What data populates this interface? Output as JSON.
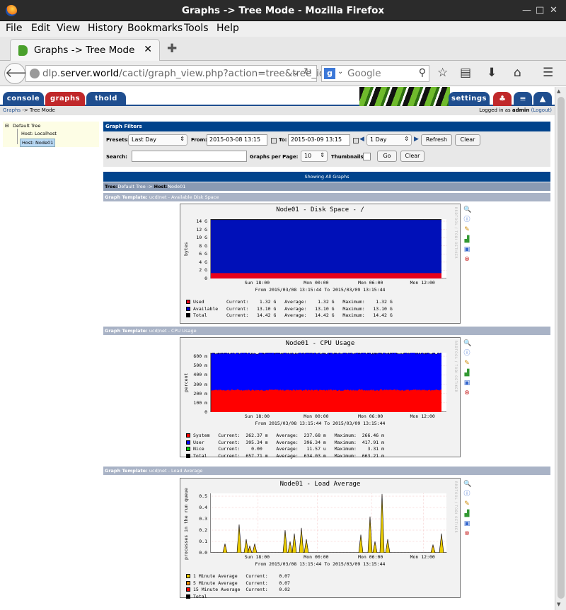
{
  "window": {
    "title": "Graphs -> Tree Mode - Mozilla Firefox"
  },
  "menu": [
    "File",
    "Edit",
    "View",
    "History",
    "Bookmarks",
    "Tools",
    "Help"
  ],
  "browser_tab": {
    "label": "Graphs -> Tree Mode"
  },
  "url": {
    "prefix": "dlp.",
    "host": "server.world",
    "path": "/cacti/graph_view.php?action=tree&tree_id="
  },
  "search": {
    "placeholder": "Google"
  },
  "cacti": {
    "tabs": [
      "console",
      "graphs",
      "thold"
    ],
    "settings": "settings",
    "breadcrumb": {
      "root": "Graphs",
      "rest": " -> Tree Mode"
    },
    "login": {
      "prefix": "Logged in as ",
      "user": "admin",
      "logout": "(Logout)"
    }
  },
  "tree": {
    "root": "Default Tree",
    "items": [
      "Host: Localhost",
      "Host: Node01"
    ]
  },
  "filters": {
    "header": "Graph Filters",
    "presets_label": "Presets:",
    "preset_value": "Last Day",
    "from_label": "From:",
    "from_value": "2015-03-08 13:15",
    "to_label": "To:",
    "to_value": "2015-03-09 13:15",
    "timespan_value": "1 Day",
    "refresh": "Refresh",
    "clear": "Clear",
    "search_label": "Search:",
    "search_value": "",
    "per_page_label": "Graphs per Page:",
    "per_page_value": "10",
    "thumbnails_label": "Thumbnails:",
    "go": "Go",
    "clear2": "Clear"
  },
  "showing": "Showing All Graphs",
  "tree_header": {
    "tree_label": "Tree:",
    "tree_value": "Default Tree",
    "sep": " -> ",
    "host_label": "Host:",
    "host_value": "Node01"
  },
  "graphs": [
    {
      "template_label": "Graph Template:",
      "template_value": "ucd/net - Available Disk Space",
      "title": "Node01 - Disk Space - /",
      "ylabel": "bytes",
      "yticks": [
        "14 G",
        "12 G",
        "10 G",
        "8 G",
        "6 G",
        "4 G",
        "2 G",
        "0"
      ],
      "xticks": [
        "Sun 18:00",
        "Mon 00:00",
        "Mon 06:00",
        "Mon 12:00"
      ],
      "subtitle": "From 2015/03/08 13:15:44 To 2015/03/09 13:15:44",
      "legend": [
        {
          "color": "#e8001a",
          "text": "Used        Current:    1.32 G   Average:    1.32 G   Maximum:    1.32 G"
        },
        {
          "color": "#0000cc",
          "text": "Available   Current:   13.10 G   Average:   13.10 G   Maximum:   13.10 G"
        },
        {
          "color": "#000000",
          "text": "Total       Current:   14.42 G   Average:   14.42 G   Maximum:   14.42 G"
        }
      ]
    },
    {
      "template_label": "Graph Template:",
      "template_value": "ucd/net - CPU Usage",
      "title": "Node01 - CPU Usage",
      "ylabel": "percent",
      "yticks": [
        "600 m",
        "500 m",
        "400 m",
        "300 m",
        "200 m",
        "100 m",
        "0"
      ],
      "xticks": [
        "Sun 18:00",
        "Mon 00:00",
        "Mon 06:00",
        "Mon 12:00"
      ],
      "subtitle": "From 2015/03/08 13:15:44 To 2015/03/09 13:15:44",
      "legend": [
        {
          "color": "#ff0000",
          "text": "System   Current:  262.37 m   Average:  237.68 m   Maximum:  266.46 m"
        },
        {
          "color": "#0000ff",
          "text": "User     Current:  395.34 m   Average:  396.34 m   Maximum:  417.91 m"
        },
        {
          "color": "#00cc00",
          "text": "Nice     Current:    0.00     Average:   11.57 u   Maximum:    3.31 m"
        },
        {
          "color": "#000000",
          "text": "Total    Current:  657.71 m   Average:  634.03 m   Maximum:  663.21 m"
        }
      ]
    },
    {
      "template_label": "Graph Template:",
      "template_value": "ucd/net - Load Average",
      "title": "Node01 - Load Average",
      "ylabel": "processes in the run queue",
      "yticks": [
        "0.5",
        "0.4",
        "0.3",
        "0.2",
        "0.1",
        "0.0"
      ],
      "xticks": [
        "Sun 18:00",
        "Mon 00:00",
        "Mon 06:00",
        "Mon 12:00"
      ],
      "subtitle": "From 2015/03/08 13:15:44 To 2015/03/09 13:15:44",
      "legend": [
        {
          "color": "#eacc00",
          "text": "1 Minute Average   Current:    0.07"
        },
        {
          "color": "#ea8f00",
          "text": "5 Minute Average   Current:    0.07"
        },
        {
          "color": "#ff0000",
          "text": "15 Minute Average  Current:    0.02"
        },
        {
          "color": "#000000",
          "text": "Total"
        }
      ]
    }
  ],
  "colors": {
    "header_blue": "#00438c",
    "tab_console": "#1f4e8f",
    "tab_graphs": "#c0282a",
    "tab_thold": "#1f4e8f",
    "tree_bg": "#fdfde5"
  }
}
